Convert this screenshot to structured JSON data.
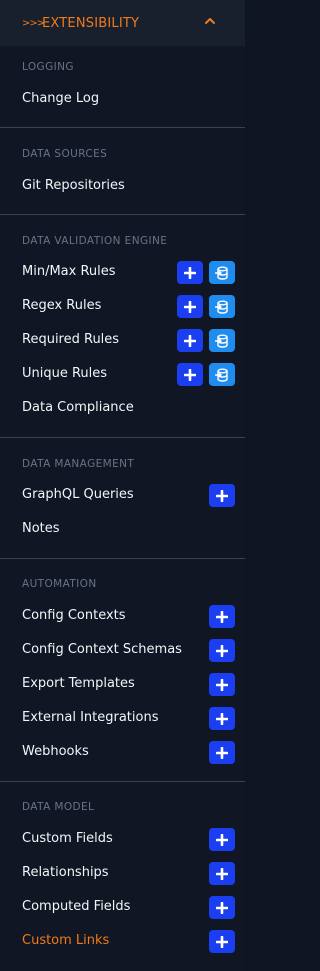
{
  "header": {
    "chevrons": ">>>",
    "title": "EXTENSIBILITY",
    "collapse_icon": "chevron-up-icon"
  },
  "sections": [
    {
      "title": "LOGGING",
      "items": [
        {
          "label": "Change Log"
        }
      ]
    },
    {
      "title": "DATA SOURCES",
      "items": [
        {
          "label": "Git Repositories"
        }
      ]
    },
    {
      "title": "DATA VALIDATION ENGINE",
      "items": [
        {
          "label": "Min/Max Rules"
        },
        {
          "label": "Regex Rules"
        },
        {
          "label": "Required Rules"
        },
        {
          "label": "Unique Rules"
        },
        {
          "label": "Data Compliance"
        }
      ]
    },
    {
      "title": "DATA MANAGEMENT",
      "items": [
        {
          "label": "GraphQL Queries"
        },
        {
          "label": "Notes"
        }
      ]
    },
    {
      "title": "AUTOMATION",
      "items": [
        {
          "label": "Config Contexts"
        },
        {
          "label": "Config Context Schemas"
        },
        {
          "label": "Export Templates"
        },
        {
          "label": "External Integrations"
        },
        {
          "label": "Webhooks"
        }
      ]
    },
    {
      "title": "DATA MODEL",
      "items": [
        {
          "label": "Custom Fields"
        },
        {
          "label": "Relationships"
        },
        {
          "label": "Computed Fields"
        },
        {
          "label": "Custom Links",
          "active": true
        }
      ]
    }
  ],
  "colors": {
    "accent": "#f07a1a",
    "add_button": "#1a3ef0",
    "import_button": "#1f8cf0",
    "background": "#101623"
  }
}
